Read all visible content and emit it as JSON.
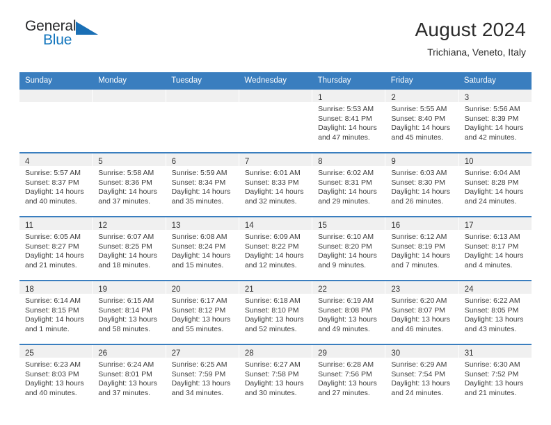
{
  "logo": {
    "word1": "General",
    "word2": "Blue",
    "triangle_color": "#1a6fb5",
    "blue_color": "#1175bd"
  },
  "header": {
    "title": "August 2024",
    "subtitle": "Trichiana, Veneto, Italy"
  },
  "theme": {
    "header_blue": "#3a7ebf",
    "daynum_band": "#f0f0f0"
  },
  "calendar": {
    "day_names": [
      "Sunday",
      "Monday",
      "Tuesday",
      "Wednesday",
      "Thursday",
      "Friday",
      "Saturday"
    ],
    "weeks": [
      [
        {
          "day": "",
          "lines": []
        },
        {
          "day": "",
          "lines": []
        },
        {
          "day": "",
          "lines": []
        },
        {
          "day": "",
          "lines": []
        },
        {
          "day": "1",
          "lines": [
            "Sunrise: 5:53 AM",
            "Sunset: 8:41 PM",
            "Daylight: 14 hours",
            "and 47 minutes."
          ]
        },
        {
          "day": "2",
          "lines": [
            "Sunrise: 5:55 AM",
            "Sunset: 8:40 PM",
            "Daylight: 14 hours",
            "and 45 minutes."
          ]
        },
        {
          "day": "3",
          "lines": [
            "Sunrise: 5:56 AM",
            "Sunset: 8:39 PM",
            "Daylight: 14 hours",
            "and 42 minutes."
          ]
        }
      ],
      [
        {
          "day": "4",
          "lines": [
            "Sunrise: 5:57 AM",
            "Sunset: 8:37 PM",
            "Daylight: 14 hours",
            "and 40 minutes."
          ]
        },
        {
          "day": "5",
          "lines": [
            "Sunrise: 5:58 AM",
            "Sunset: 8:36 PM",
            "Daylight: 14 hours",
            "and 37 minutes."
          ]
        },
        {
          "day": "6",
          "lines": [
            "Sunrise: 5:59 AM",
            "Sunset: 8:34 PM",
            "Daylight: 14 hours",
            "and 35 minutes."
          ]
        },
        {
          "day": "7",
          "lines": [
            "Sunrise: 6:01 AM",
            "Sunset: 8:33 PM",
            "Daylight: 14 hours",
            "and 32 minutes."
          ]
        },
        {
          "day": "8",
          "lines": [
            "Sunrise: 6:02 AM",
            "Sunset: 8:31 PM",
            "Daylight: 14 hours",
            "and 29 minutes."
          ]
        },
        {
          "day": "9",
          "lines": [
            "Sunrise: 6:03 AM",
            "Sunset: 8:30 PM",
            "Daylight: 14 hours",
            "and 26 minutes."
          ]
        },
        {
          "day": "10",
          "lines": [
            "Sunrise: 6:04 AM",
            "Sunset: 8:28 PM",
            "Daylight: 14 hours",
            "and 24 minutes."
          ]
        }
      ],
      [
        {
          "day": "11",
          "lines": [
            "Sunrise: 6:05 AM",
            "Sunset: 8:27 PM",
            "Daylight: 14 hours",
            "and 21 minutes."
          ]
        },
        {
          "day": "12",
          "lines": [
            "Sunrise: 6:07 AM",
            "Sunset: 8:25 PM",
            "Daylight: 14 hours",
            "and 18 minutes."
          ]
        },
        {
          "day": "13",
          "lines": [
            "Sunrise: 6:08 AM",
            "Sunset: 8:24 PM",
            "Daylight: 14 hours",
            "and 15 minutes."
          ]
        },
        {
          "day": "14",
          "lines": [
            "Sunrise: 6:09 AM",
            "Sunset: 8:22 PM",
            "Daylight: 14 hours",
            "and 12 minutes."
          ]
        },
        {
          "day": "15",
          "lines": [
            "Sunrise: 6:10 AM",
            "Sunset: 8:20 PM",
            "Daylight: 14 hours",
            "and 9 minutes."
          ]
        },
        {
          "day": "16",
          "lines": [
            "Sunrise: 6:12 AM",
            "Sunset: 8:19 PM",
            "Daylight: 14 hours",
            "and 7 minutes."
          ]
        },
        {
          "day": "17",
          "lines": [
            "Sunrise: 6:13 AM",
            "Sunset: 8:17 PM",
            "Daylight: 14 hours",
            "and 4 minutes."
          ]
        }
      ],
      [
        {
          "day": "18",
          "lines": [
            "Sunrise: 6:14 AM",
            "Sunset: 8:15 PM",
            "Daylight: 14 hours",
            "and 1 minute."
          ]
        },
        {
          "day": "19",
          "lines": [
            "Sunrise: 6:15 AM",
            "Sunset: 8:14 PM",
            "Daylight: 13 hours",
            "and 58 minutes."
          ]
        },
        {
          "day": "20",
          "lines": [
            "Sunrise: 6:17 AM",
            "Sunset: 8:12 PM",
            "Daylight: 13 hours",
            "and 55 minutes."
          ]
        },
        {
          "day": "21",
          "lines": [
            "Sunrise: 6:18 AM",
            "Sunset: 8:10 PM",
            "Daylight: 13 hours",
            "and 52 minutes."
          ]
        },
        {
          "day": "22",
          "lines": [
            "Sunrise: 6:19 AM",
            "Sunset: 8:08 PM",
            "Daylight: 13 hours",
            "and 49 minutes."
          ]
        },
        {
          "day": "23",
          "lines": [
            "Sunrise: 6:20 AM",
            "Sunset: 8:07 PM",
            "Daylight: 13 hours",
            "and 46 minutes."
          ]
        },
        {
          "day": "24",
          "lines": [
            "Sunrise: 6:22 AM",
            "Sunset: 8:05 PM",
            "Daylight: 13 hours",
            "and 43 minutes."
          ]
        }
      ],
      [
        {
          "day": "25",
          "lines": [
            "Sunrise: 6:23 AM",
            "Sunset: 8:03 PM",
            "Daylight: 13 hours",
            "and 40 minutes."
          ]
        },
        {
          "day": "26",
          "lines": [
            "Sunrise: 6:24 AM",
            "Sunset: 8:01 PM",
            "Daylight: 13 hours",
            "and 37 minutes."
          ]
        },
        {
          "day": "27",
          "lines": [
            "Sunrise: 6:25 AM",
            "Sunset: 7:59 PM",
            "Daylight: 13 hours",
            "and 34 minutes."
          ]
        },
        {
          "day": "28",
          "lines": [
            "Sunrise: 6:27 AM",
            "Sunset: 7:58 PM",
            "Daylight: 13 hours",
            "and 30 minutes."
          ]
        },
        {
          "day": "29",
          "lines": [
            "Sunrise: 6:28 AM",
            "Sunset: 7:56 PM",
            "Daylight: 13 hours",
            "and 27 minutes."
          ]
        },
        {
          "day": "30",
          "lines": [
            "Sunrise: 6:29 AM",
            "Sunset: 7:54 PM",
            "Daylight: 13 hours",
            "and 24 minutes."
          ]
        },
        {
          "day": "31",
          "lines": [
            "Sunrise: 6:30 AM",
            "Sunset: 7:52 PM",
            "Daylight: 13 hours",
            "and 21 minutes."
          ]
        }
      ]
    ]
  }
}
